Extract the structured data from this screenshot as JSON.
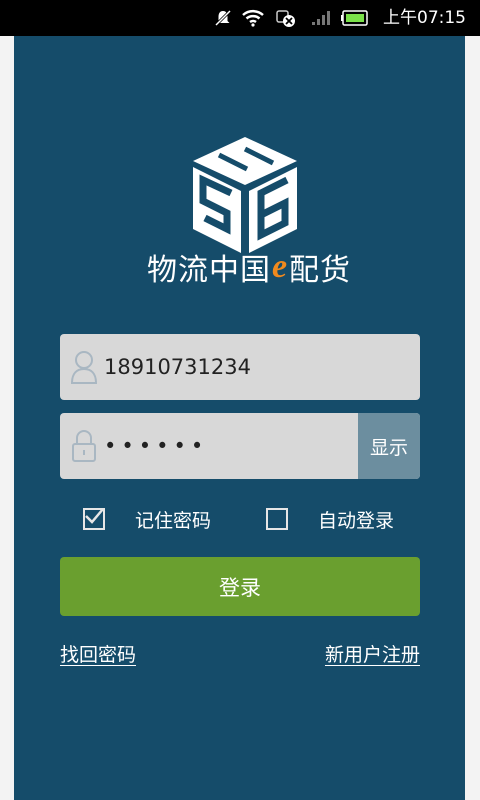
{
  "status_bar": {
    "time": "上午07:15",
    "icons": [
      "notification-off-icon",
      "wifi-icon",
      "sync-error-icon",
      "signal-icon",
      "battery-icon"
    ],
    "battery_color": "#7be24a"
  },
  "brand": {
    "logo_text": "56",
    "name_part1": "物流中国",
    "name_e": "e",
    "name_part2": "配货",
    "accent_color": "#f08a1e"
  },
  "login": {
    "username_value": "18910731234",
    "password_value": "••••••",
    "show_password_label": "显示",
    "remember_password_label": "记住密码",
    "remember_password_checked": true,
    "auto_login_label": "自动登录",
    "auto_login_checked": false,
    "login_button_label": "登录",
    "forgot_password_link": "找回密码",
    "register_link": "新用户注册"
  },
  "colors": {
    "background": "#154c6a",
    "field": "#d8d8d8",
    "show_button": "#6c8e9f",
    "login_button": "#6a9f2f"
  }
}
